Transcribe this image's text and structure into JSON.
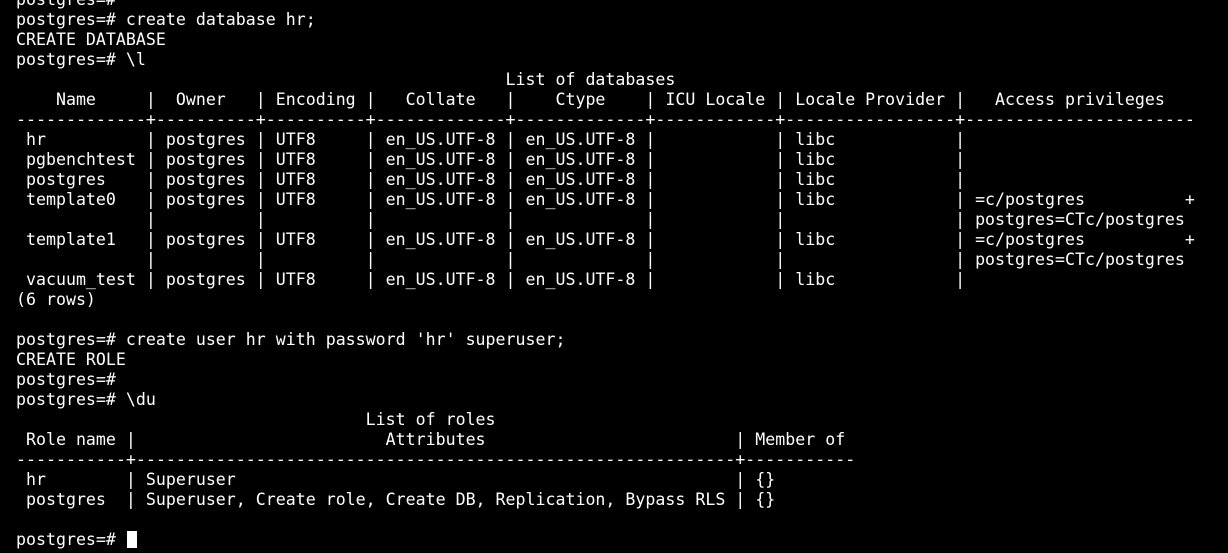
{
  "terminal": {
    "colors": {
      "background": "#000000",
      "foreground": "#ffffff"
    },
    "lines": [
      "postgres=#",
      "postgres=# create database hr;",
      "CREATE DATABASE",
      "postgres=# \\l",
      "                                                 List of databases",
      "    Name     |  Owner   | Encoding |   Collate   |    Ctype    | ICU Locale | Locale Provider |   Access privileges",
      "-------------+----------+----------+-------------+-------------+------------+-----------------+-----------------------",
      " hr          | postgres | UTF8     | en_US.UTF-8 | en_US.UTF-8 |            | libc            |",
      " pgbenchtest | postgres | UTF8     | en_US.UTF-8 | en_US.UTF-8 |            | libc            |",
      " postgres    | postgres | UTF8     | en_US.UTF-8 | en_US.UTF-8 |            | libc            |",
      " template0   | postgres | UTF8     | en_US.UTF-8 | en_US.UTF-8 |            | libc            | =c/postgres          +",
      "             |          |          |             |             |            |                 | postgres=CTc/postgres",
      " template1   | postgres | UTF8     | en_US.UTF-8 | en_US.UTF-8 |            | libc            | =c/postgres          +",
      "             |          |          |             |             |            |                 | postgres=CTc/postgres",
      " vacuum_test | postgres | UTF8     | en_US.UTF-8 | en_US.UTF-8 |            | libc            |",
      "(6 rows)",
      "",
      "postgres=# create user hr with password 'hr' superuser;",
      "CREATE ROLE",
      "postgres=#",
      "postgres=# \\du",
      "                                   List of roles",
      " Role name |                         Attributes                         | Member of",
      "-----------+------------------------------------------------------------+-----------",
      " hr        | Superuser                                                  | {}",
      " postgres  | Superuser, Create role, Create DB, Replication, Bypass RLS | {}",
      ""
    ],
    "prompt": "postgres=# "
  }
}
